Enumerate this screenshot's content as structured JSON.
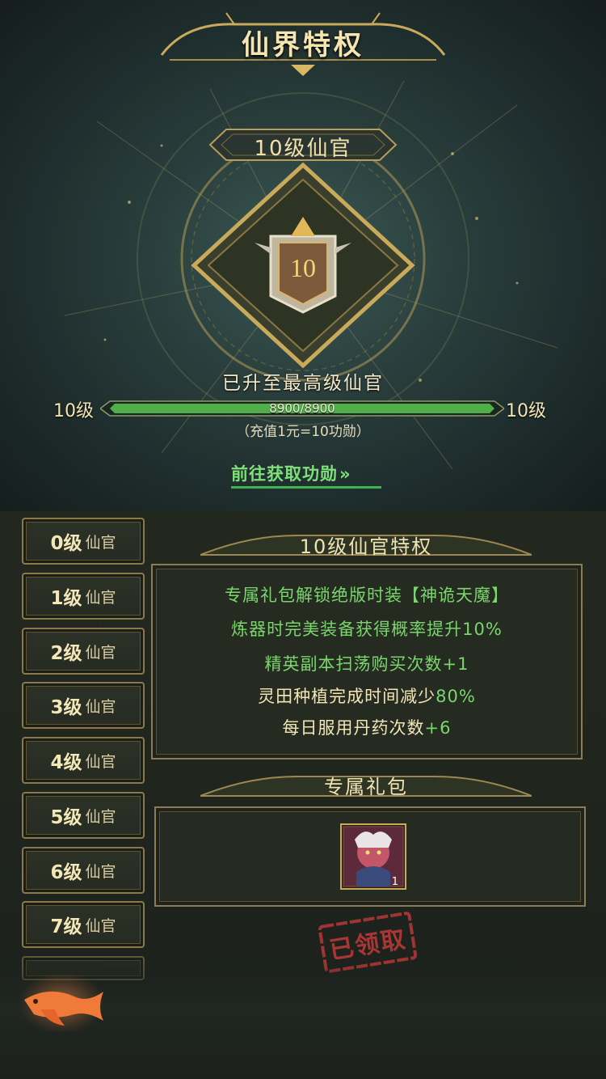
{
  "header": {
    "title": "仙界特权"
  },
  "rank": {
    "title": "10级仙官",
    "emblem_number": "10",
    "status": "已升至最高级仙官",
    "level_left": "10级",
    "level_right": "10级",
    "progress_text": "8900/8900",
    "progress_fraction": 1.0,
    "rate_note": "（充值1元=10功勋）",
    "goto_label": "前往获取功勋",
    "goto_arrows": "»"
  },
  "levels": [
    {
      "num": "0级",
      "suffix": "仙官"
    },
    {
      "num": "1级",
      "suffix": "仙官"
    },
    {
      "num": "2级",
      "suffix": "仙官"
    },
    {
      "num": "3级",
      "suffix": "仙官"
    },
    {
      "num": "4级",
      "suffix": "仙官"
    },
    {
      "num": "5级",
      "suffix": "仙官"
    },
    {
      "num": "6级",
      "suffix": "仙官"
    },
    {
      "num": "7级",
      "suffix": "仙官"
    }
  ],
  "privileges": {
    "header": "10级仙官特权",
    "lines": [
      {
        "text": "专属礼包解锁绝版时装【神诡天魔】"
      },
      {
        "text": "炼器时完美装备获得概率提升10%"
      },
      {
        "text": "精英副本扫荡购买次数+1"
      },
      {
        "prefix": "灵田种植完成时间减少",
        "value": "80%"
      },
      {
        "prefix": "每日服用丹药次数",
        "value": "+6"
      }
    ]
  },
  "gift": {
    "header": "专属礼包",
    "item_count": "1",
    "claimed_label": "已领取"
  },
  "colors": {
    "highlight_green": "#79d66c",
    "gold_text": "#f2e6b6",
    "stamp_red": "#c23a3a",
    "progress_green": "#4fb04a"
  }
}
